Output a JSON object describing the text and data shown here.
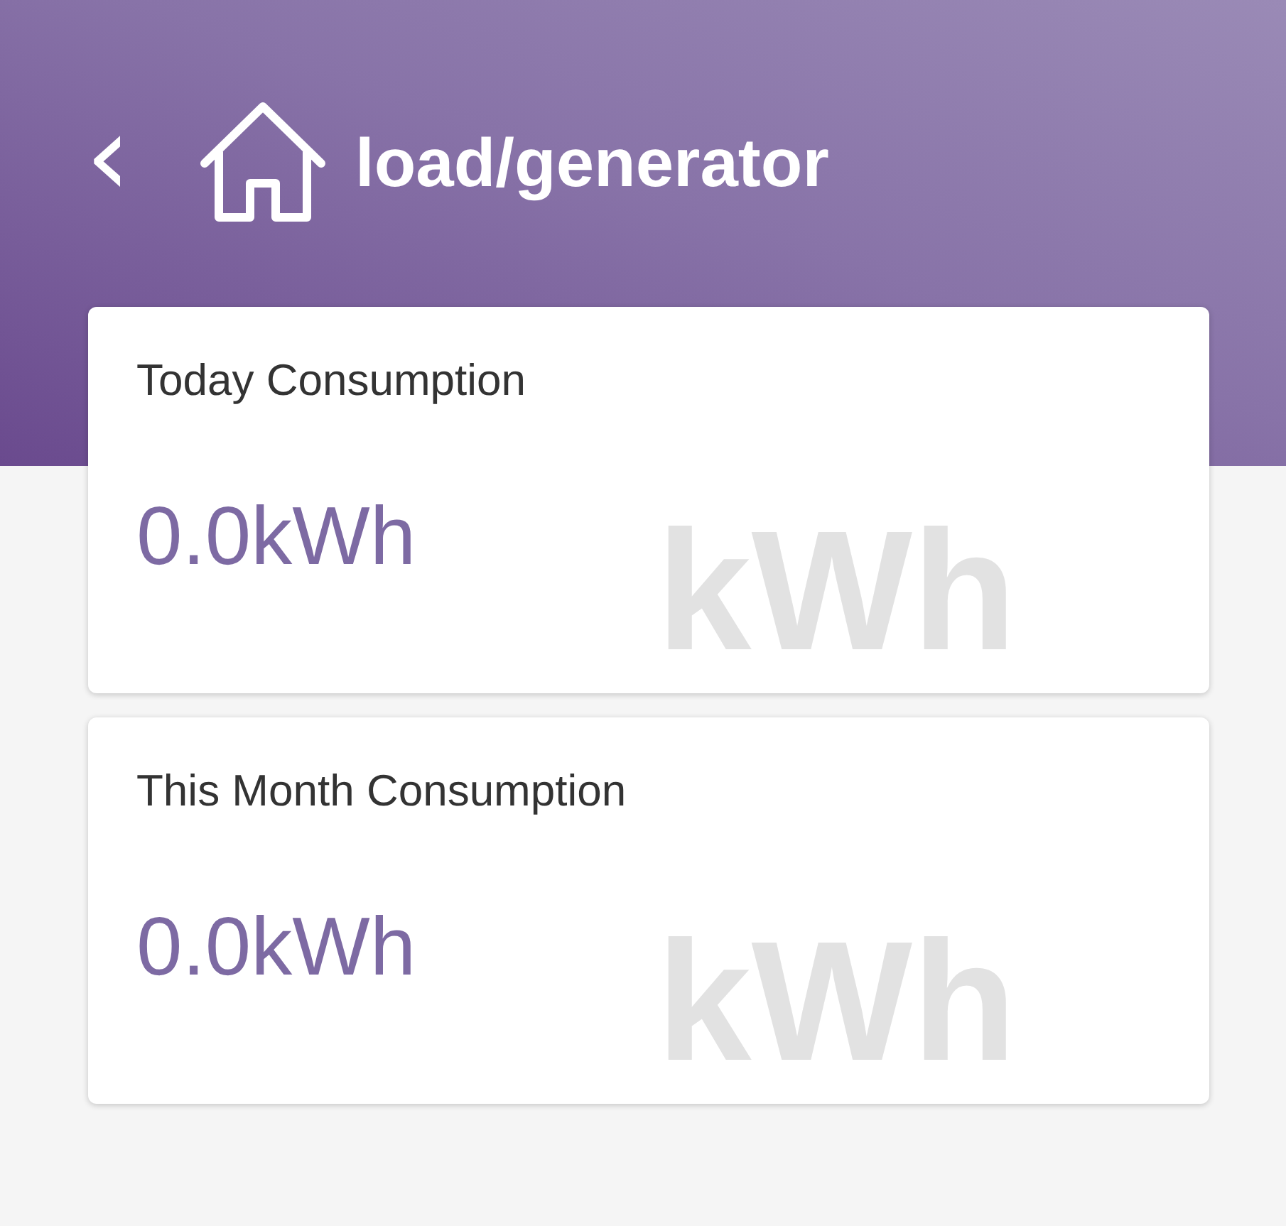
{
  "header": {
    "back": "‹",
    "title": "load/generator"
  },
  "cards": [
    {
      "label": "Today Consumption",
      "value": "0.0kWh",
      "background_text": "kWh"
    },
    {
      "label": "This Month Consumption",
      "value": "0.0kWh",
      "background_text": "kWh"
    }
  ]
}
